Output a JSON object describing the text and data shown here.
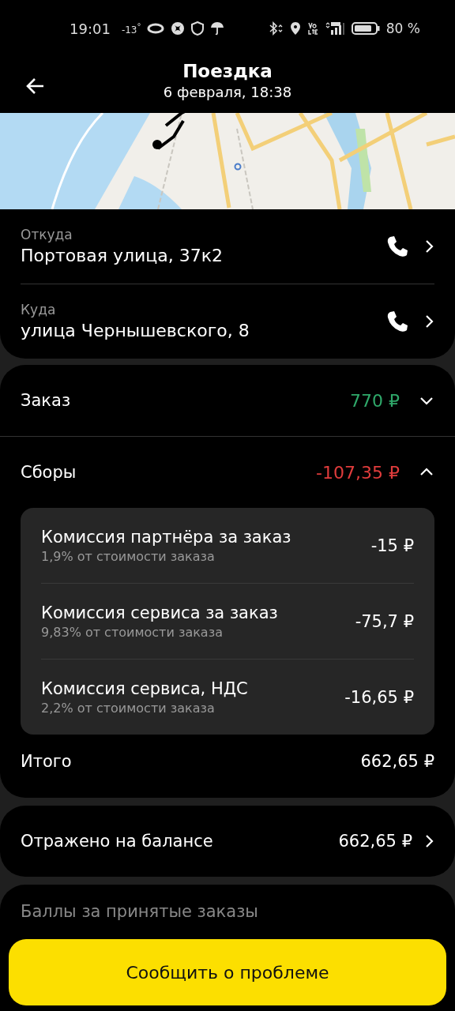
{
  "status_bar": {
    "time": "19:01",
    "temperature": "-13$^{°}$",
    "battery": "80 %"
  },
  "header": {
    "title": "Поездка",
    "subtitle": "6 февраля, 18:38"
  },
  "addresses": [
    {
      "label": "Откуда",
      "value": "Портовая улица, 37к2"
    },
    {
      "label": "Куда",
      "value": "улица Чернышевского, 8"
    }
  ],
  "sections": [
    {
      "title": "Заказ",
      "amount": "770 ₽",
      "color": "#2fa86a",
      "expanded": false
    },
    {
      "title": "Сборы",
      "amount": "-107,35 ₽",
      "color": "#e03c3c",
      "expanded": true,
      "items": [
        {
          "title": "Комиссия партнёра за заказ",
          "note": "1,9% от стоимости заказа",
          "amount": "-15 ₽"
        },
        {
          "title": "Комиссия сервиса за заказ",
          "note": "9,83% от стоимости заказа",
          "amount": "-75,7 ₽"
        },
        {
          "title": "Комиссия сервиса, НДС",
          "note": "2,2% от стоимости заказа",
          "amount": "-16,65 ₽"
        }
      ]
    }
  ],
  "total": {
    "label": "Итого",
    "amount": "662,65 ₽"
  },
  "balance": {
    "label": "Отражено на балансе",
    "amount": "662,65 ₽"
  },
  "points": {
    "label": "Баллы за принятые заказы"
  },
  "report_button": "Сообщить о проблеме"
}
